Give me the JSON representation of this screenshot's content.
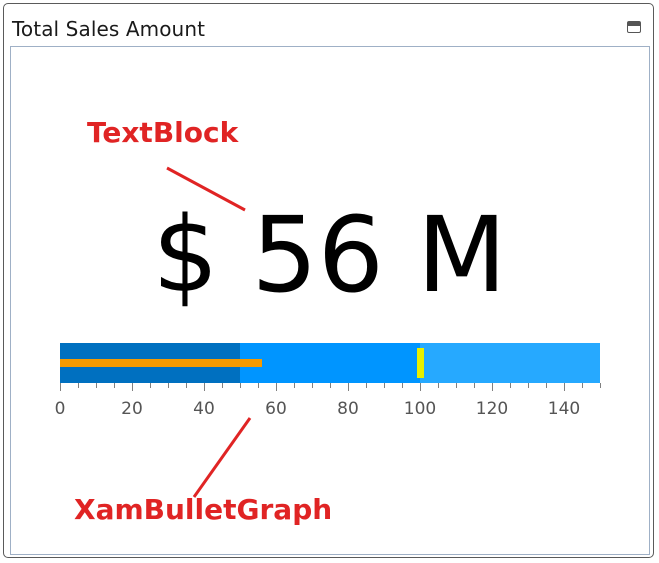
{
  "panel": {
    "title": "Total Sales Amount",
    "window_icon": "window-maximize-icon"
  },
  "value_display": {
    "text": "$ 56 M"
  },
  "bullet_graph": {
    "min": 0,
    "max": 150,
    "value": 56,
    "target": 100,
    "ranges": [
      {
        "start": 0,
        "end": 50,
        "color": "#0070c0"
      },
      {
        "start": 50,
        "end": 100,
        "color": "#0095ff"
      },
      {
        "start": 100,
        "end": 150,
        "color": "#26a9ff"
      }
    ],
    "value_color": "#f59a00",
    "target_color": "#e8f000",
    "major_interval": 20,
    "minor_interval": 5,
    "tick_labels": [
      "0",
      "20",
      "40",
      "60",
      "80",
      "100",
      "120",
      "140"
    ]
  },
  "annotations": {
    "textblock_label": "TextBlock",
    "bullet_label": "XamBulletGraph",
    "color": "#e02424"
  }
}
